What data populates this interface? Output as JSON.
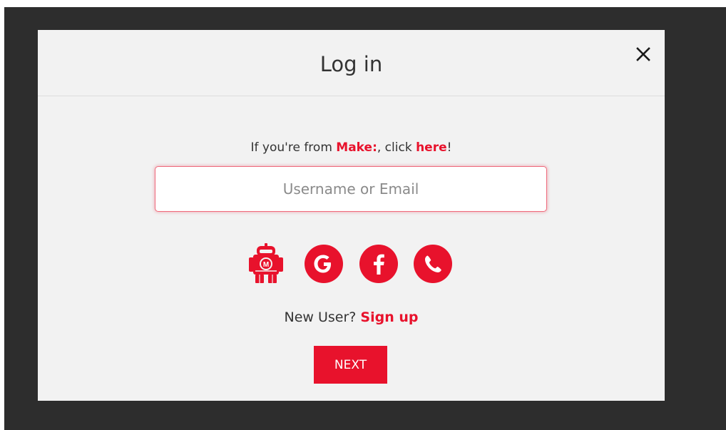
{
  "modal": {
    "title": "Log in",
    "close_icon": "close-icon"
  },
  "intro": {
    "prefix": "If you're from ",
    "brand": "Make:",
    "middle": ", click ",
    "link": "here",
    "suffix": "!"
  },
  "login_input": {
    "placeholder": "Username or Email",
    "value": ""
  },
  "social_logins": [
    {
      "name": "maker-robot-icon",
      "label": "Make:"
    },
    {
      "name": "google-icon",
      "label": "G"
    },
    {
      "name": "facebook-icon",
      "label": "f"
    },
    {
      "name": "phone-icon",
      "label": "phone"
    }
  ],
  "signup": {
    "prompt": "New User? ",
    "link": "Sign up"
  },
  "next_button": {
    "label": "NEXT"
  },
  "colors": {
    "accent": "#e8122c",
    "overlay": "#2d2d2d",
    "modal_bg": "#f2f2f2",
    "text": "#333333"
  }
}
